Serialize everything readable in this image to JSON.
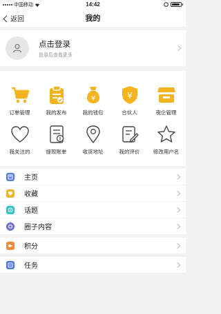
{
  "status": {
    "carrier": "中国移动",
    "time": "14:42"
  },
  "nav": {
    "back": "返回",
    "title": "我的"
  },
  "profile": {
    "title": "点击登录",
    "subtitle": "登录后查看更多"
  },
  "grid1": [
    {
      "label": "订单管理",
      "icon": "cart-icon"
    },
    {
      "label": "我的发布",
      "icon": "clipboard-icon"
    },
    {
      "label": "我的钱包",
      "icon": "moneybag-icon"
    },
    {
      "label": "合伙人",
      "icon": "shield-yen-icon"
    },
    {
      "label": "夜企管理",
      "icon": "shop-icon"
    }
  ],
  "grid2": [
    {
      "label": "我关注的",
      "icon": "heart-icon"
    },
    {
      "label": "提现账单",
      "icon": "bill-icon"
    },
    {
      "label": "收货地址",
      "icon": "location-icon"
    },
    {
      "label": "我的评价",
      "icon": "edit-icon"
    },
    {
      "label": "修改用户名",
      "icon": "star-icon"
    }
  ],
  "menu": [
    {
      "label": "主页",
      "color": "#5b7fde"
    },
    {
      "label": "收藏",
      "color": "#f0b323"
    },
    {
      "label": "话题",
      "color": "#34c2c9"
    },
    {
      "label": "圈子内容",
      "color": "#6b6ede"
    },
    {
      "label": "积分",
      "color": "#f08a3c"
    },
    {
      "label": "任务",
      "color": "#4a78e0"
    }
  ],
  "colors": {
    "accent": "#f5b320"
  }
}
